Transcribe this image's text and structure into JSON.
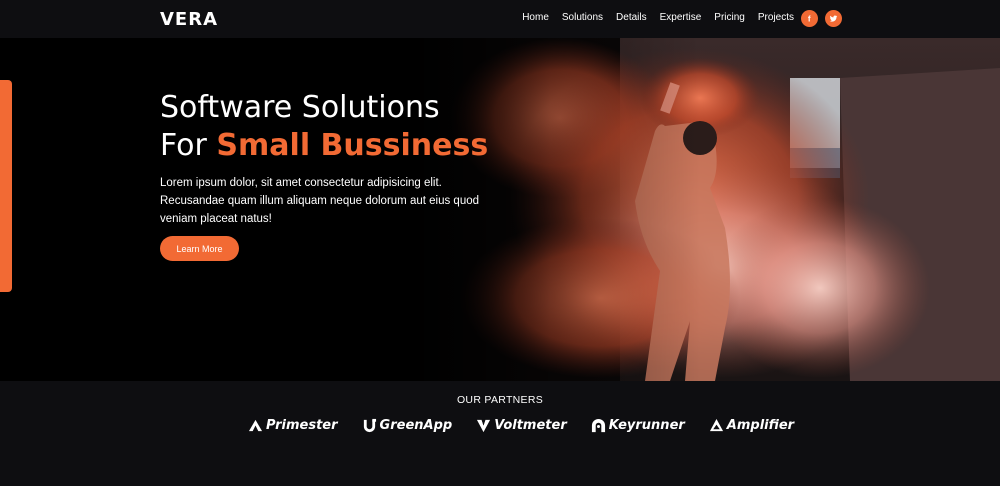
{
  "brand": {
    "name": "VERA"
  },
  "nav": {
    "items": [
      "Home",
      "Solutions",
      "Details",
      "Expertise",
      "Pricing",
      "Projects"
    ],
    "social": [
      {
        "icon": "facebook-icon",
        "glyph": "f"
      },
      {
        "icon": "twitter-icon",
        "glyph": "twitter"
      }
    ]
  },
  "hero": {
    "title_line1": "Software Solutions",
    "title_line2_prefix": "For ",
    "title_line2_accent": "Small Bussiness",
    "description": "Lorem ipsum dolor, sit amet consectetur adipisicing elit. Recusandae quam illum aliquam neque dolorum aut eius quod veniam placeat natus!",
    "button_label": "Learn More"
  },
  "partners": {
    "title": "OUR PARTNERS",
    "items": [
      {
        "name": "Primester",
        "icon": "primester-logo-icon"
      },
      {
        "name": "GreenApp",
        "icon": "greenapp-logo-icon"
      },
      {
        "name": "Voltmeter",
        "icon": "voltmeter-logo-icon"
      },
      {
        "name": "Keyrunner",
        "icon": "keyrunner-logo-icon"
      },
      {
        "name": "Amplifier",
        "icon": "amplifier-logo-icon"
      }
    ]
  },
  "colors": {
    "accent": "#f26a34",
    "background": "#0e0e11",
    "text": "#ffffff"
  }
}
